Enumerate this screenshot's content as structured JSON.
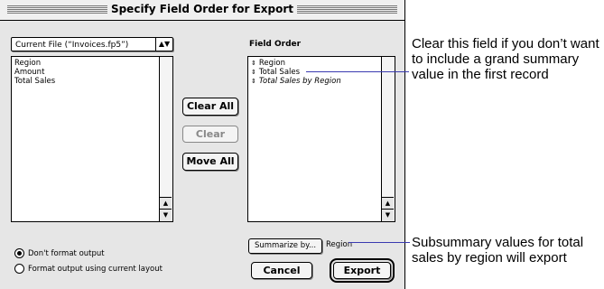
{
  "dialog": {
    "title": "Specify Field Order for Export",
    "source_popup": "Current File (“Invoices.fp5”)",
    "source_fields": [
      "Region",
      "Amount",
      "Total Sales"
    ],
    "field_order_label": "Field Order",
    "field_order": [
      {
        "label": "Region",
        "italic": false
      },
      {
        "label": "Total Sales",
        "italic": false
      },
      {
        "label": "Total Sales by Region",
        "italic": true
      }
    ],
    "buttons": {
      "clear_all": "Clear All",
      "clear": "Clear",
      "move_all": "Move All",
      "summarize_by": "Summarize by...",
      "summarize_value": "Region",
      "cancel": "Cancel",
      "export": "Export"
    },
    "format_options": {
      "dont_format": "Don't format output",
      "format_layout": "Format output using current layout",
      "selected": "dont_format"
    }
  },
  "callouts": {
    "top": "Clear this field if you don’t want to include a grand summary value in the first record",
    "bottom": "Subsummary values for total sales by region will export"
  },
  "colors": {
    "callout_line": "#3a3ab0"
  }
}
